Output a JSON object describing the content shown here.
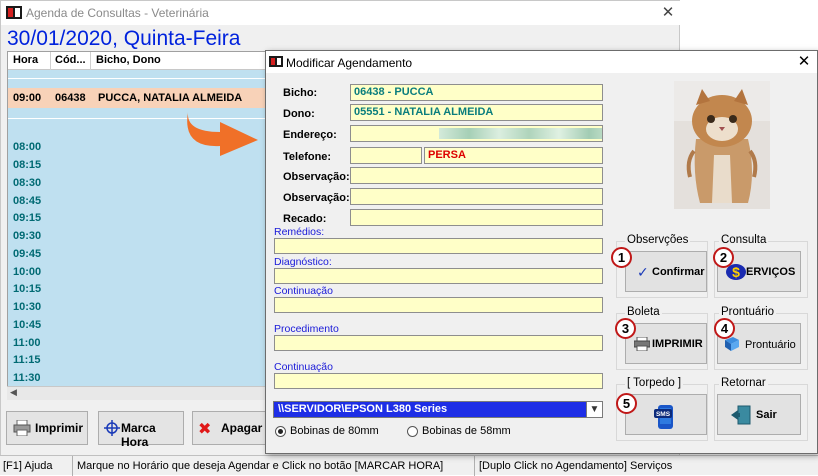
{
  "main": {
    "title": "Agenda de Consultas - Veterinária",
    "date_header": "30/01/2020, Quinta-Feira",
    "columns": [
      "Hora",
      "Cód...",
      "Bicho, Dono"
    ],
    "appointment": {
      "hora": "09:00",
      "codigo": "06438",
      "bicho_dono": "PUCCA, NATALIA ALMEIDA"
    },
    "times": [
      "08:00",
      "08:15",
      "08:30",
      "08:45",
      "09:15",
      "09:30",
      "09:45",
      "10:00",
      "10:15",
      "10:30",
      "10:45",
      "11:00",
      "11:15",
      "11:30"
    ],
    "buttons": {
      "imprimir": "Imprimir",
      "marca_hora": "Marca Hora",
      "apagar": "Apagar"
    }
  },
  "statusbar": {
    "help": "[F1] Ajuda",
    "hint": "Marque no Horário que deseja Agendar e Click no botão [MARCAR HORA]",
    "services": "[Duplo Click no Agendamento] Serviços"
  },
  "dialog": {
    "title": "Modificar Agendamento",
    "labels": {
      "bicho": "Bicho:",
      "dono": "Dono:",
      "endereco": "Endereço:",
      "telefone": "Telefone:",
      "observacao1": "Observação:",
      "observacao2": "Observação:",
      "recado": "Recado:",
      "remedios": "Remédios:",
      "diagnostico": "Diagnóstico:",
      "continuacao1": "Continuação",
      "procedimento": "Procedimento",
      "continuacao2": "Continuação"
    },
    "values": {
      "bicho": "06438 - PUCCA",
      "dono": "05551 - NATALIA ALMEIDA",
      "telefone": "",
      "raca": "PERSA"
    },
    "printer": "\\\\SERVIDOR\\EPSON L380 Series",
    "radio": {
      "bobina80": "Bobinas de 80mm",
      "bobina58": "Bobinas de 58mm",
      "selected": "bobina80"
    },
    "groups": {
      "observacoes": "Observções",
      "consulta": "Consulta",
      "boleta": "Boleta",
      "prontuario": "Prontuário",
      "torpedo": "[ Torpedo ]",
      "retornar": "Retornar"
    },
    "buttons": {
      "confirmar": "Confirmar",
      "servicos": "ERVIÇOS",
      "imprimir": "IMPRIMIR",
      "prontuario": "Prontuário",
      "sms": "SMS",
      "sair": "Sair"
    },
    "badges": [
      "1",
      "2",
      "3",
      "4",
      "5"
    ]
  },
  "colors": {
    "date_blue": "#0022dd",
    "teal_text": "#0a7d7d",
    "red_text": "#dd0000",
    "field_yellow": "#ffffc8",
    "printer_blue": "#1e2ee6",
    "arrow_orange": "#f07028",
    "appointment_row": "#f8d2b8",
    "grid_blue": "#bfe0f0"
  }
}
